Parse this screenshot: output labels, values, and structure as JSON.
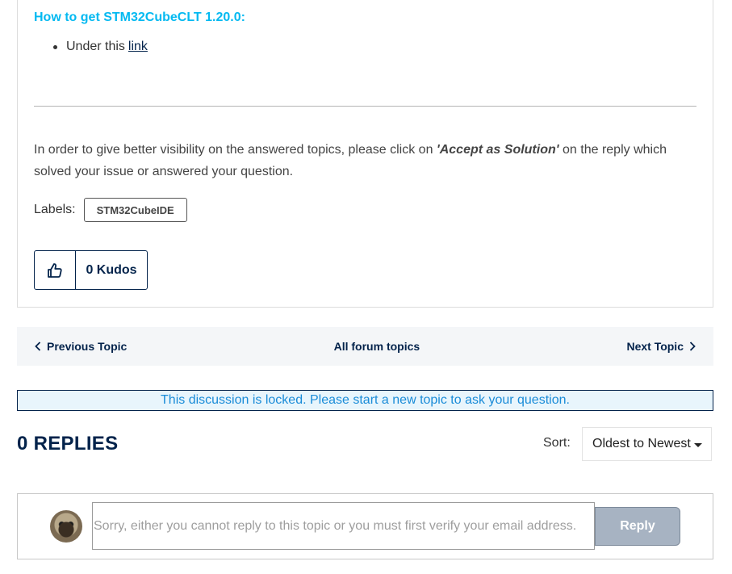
{
  "post": {
    "heading": "How to get STM32CubeCLT 1.20.0:",
    "bullet_prefix": "Under this",
    "bullet_link": "link",
    "note_before": "In order to give better visibility on the answered topics, please click on ",
    "note_emphasis": "'Accept as Solution'",
    "note_after": " on the reply which solved your issue or answered your question.",
    "labels_caption": "Labels:",
    "label_chip": "STM32CubeIDE",
    "kudos": "0 Kudos"
  },
  "topic_nav": {
    "previous": "Previous Topic",
    "all": "All forum topics",
    "next": "Next Topic"
  },
  "locked_message": "This discussion is locked. Please start a new topic to ask your question.",
  "replies": {
    "title": "0 REPLIES",
    "sort_caption": "Sort:",
    "sort_value": "Oldest to Newest"
  },
  "reply_box": {
    "placeholder": "Sorry, either you cannot reply to this topic or you must first verify your email address.",
    "button": "Reply"
  },
  "colors": {
    "heading": "#03b9f1",
    "navy": "#03234b",
    "locked_text": "#1a8cd8",
    "reply_button": "#a7b3c2"
  },
  "icons": [
    "thumbs-up-icon",
    "chevron-left-icon",
    "chevron-right-icon",
    "caret-down-icon",
    "user-avatar"
  ]
}
